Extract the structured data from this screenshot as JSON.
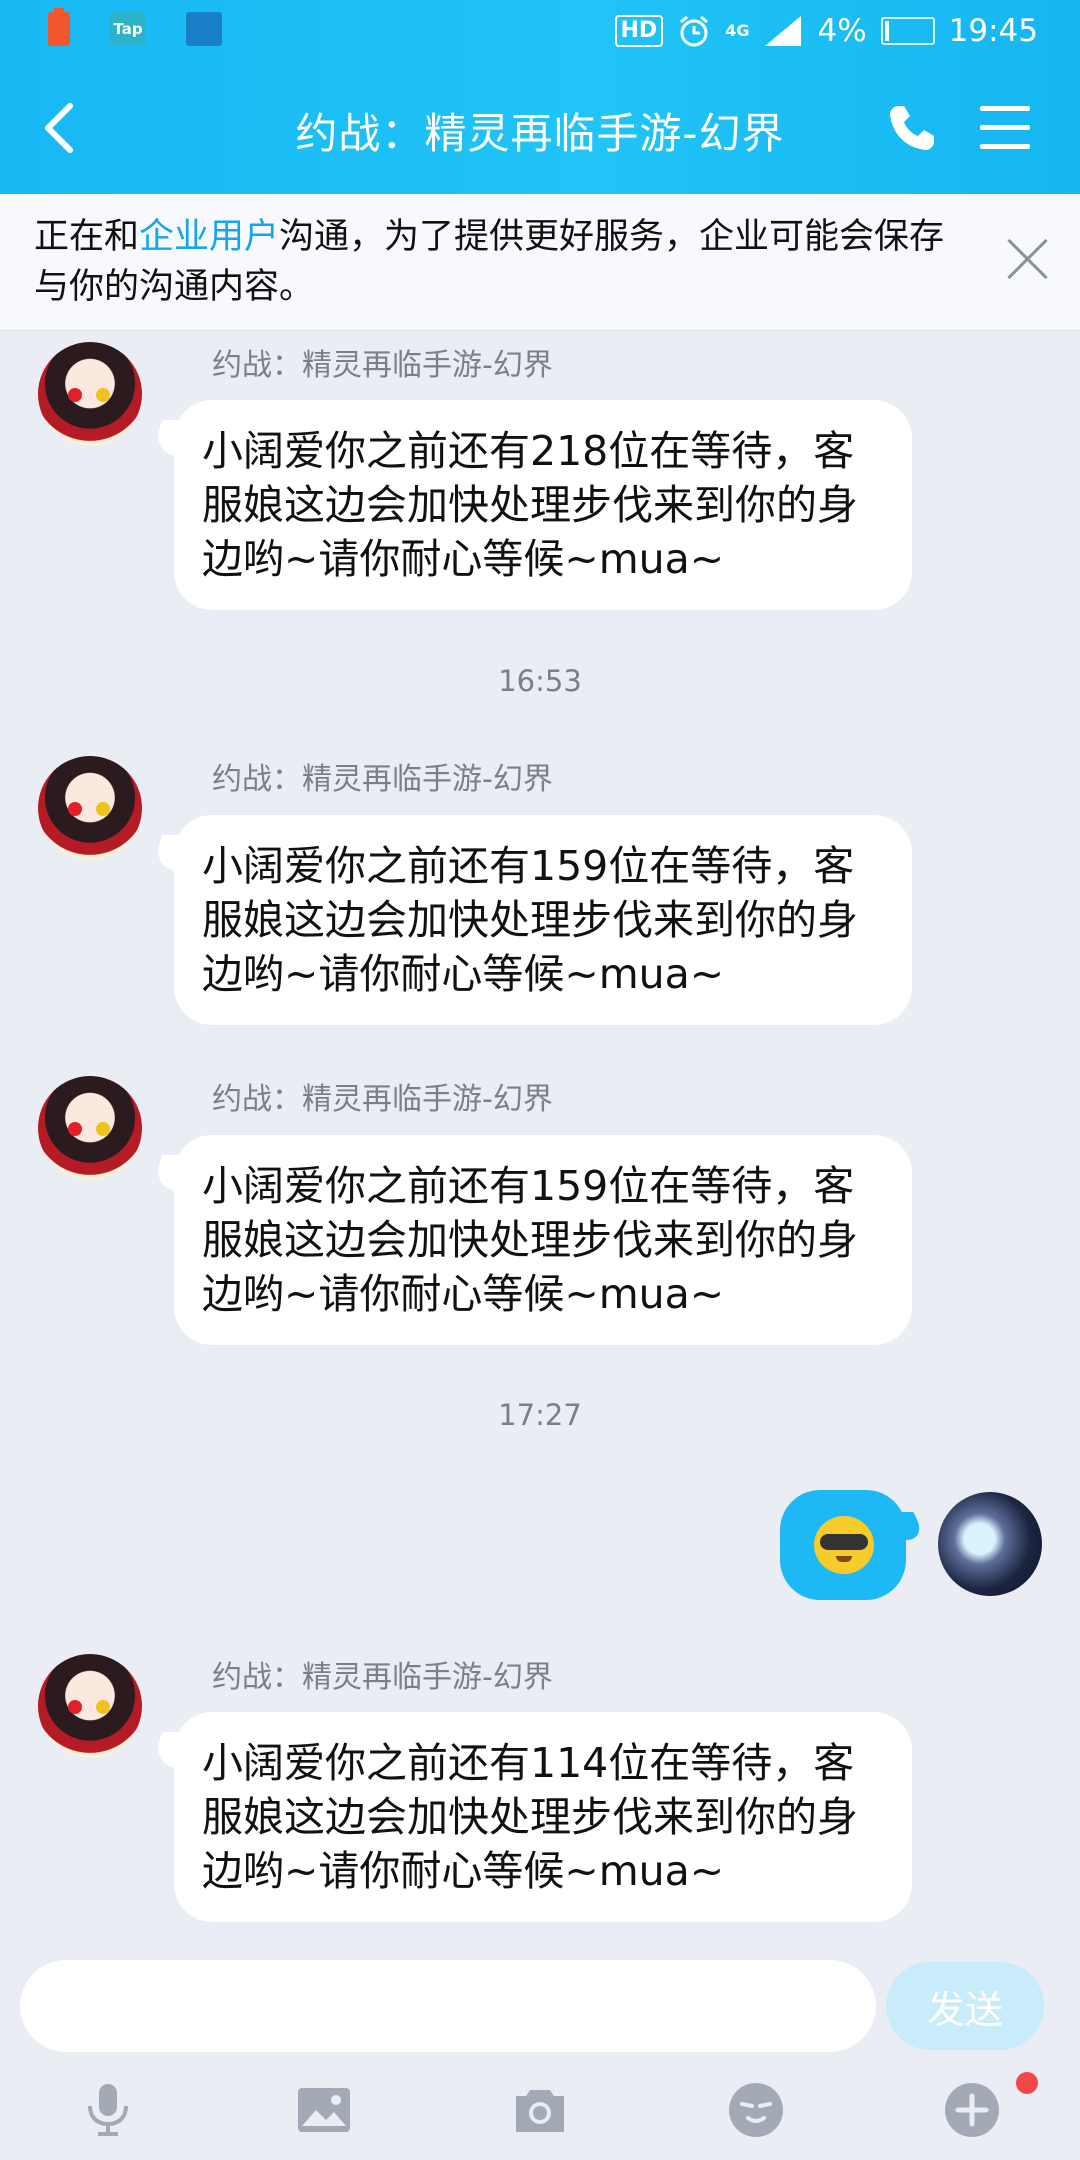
{
  "status_bar": {
    "app_icons": [
      "battery-alert-icon",
      "tap-icon",
      "app-square-icon"
    ],
    "tap_label": "Tap",
    "hd_label": "HD",
    "network_label": "4G",
    "battery_percent": "4%",
    "time": "19:45"
  },
  "header": {
    "title": "约战：精灵再临手游-幻界"
  },
  "notice": {
    "prefix": "正在和",
    "highlight": "企业用户",
    "suffix": "沟通，为了提供更好服务，企业可能会保存与你的沟通内容。"
  },
  "chat": {
    "times": [
      "16:53",
      "17:27"
    ],
    "messages": [
      {
        "sender": "约战：精灵再临手游-幻界",
        "text": "小阔爱你之前还有218位在等待，客服娘这边会加快处理步伐来到你的身边哟~请你耐心等候~mua~"
      },
      {
        "sender": "约战：精灵再临手游-幻界",
        "text": "小阔爱你之前还有159位在等待，客服娘这边会加快处理步伐来到你的身边哟~请你耐心等候~mua~"
      },
      {
        "sender": "约战：精灵再临手游-幻界",
        "text": "小阔爱你之前还有159位在等待，客服娘这边会加快处理步伐来到你的身边哟~请你耐心等候~mua~"
      },
      {
        "sender": "约战：精灵再临手游-幻界",
        "text": "小阔爱你之前还有114位在等待，客服娘这边会加快处理步伐来到你的身边哟~请你耐心等候~mua~"
      }
    ]
  },
  "composer": {
    "placeholder": "",
    "send_label": "发送"
  },
  "colors": {
    "header": "#1eb9f6",
    "accent": "#14a6ec",
    "badge": "#f04848"
  },
  "toolbar_icons": [
    "microphone-icon",
    "image-icon",
    "camera-icon",
    "emoji-icon",
    "plus-icon"
  ]
}
